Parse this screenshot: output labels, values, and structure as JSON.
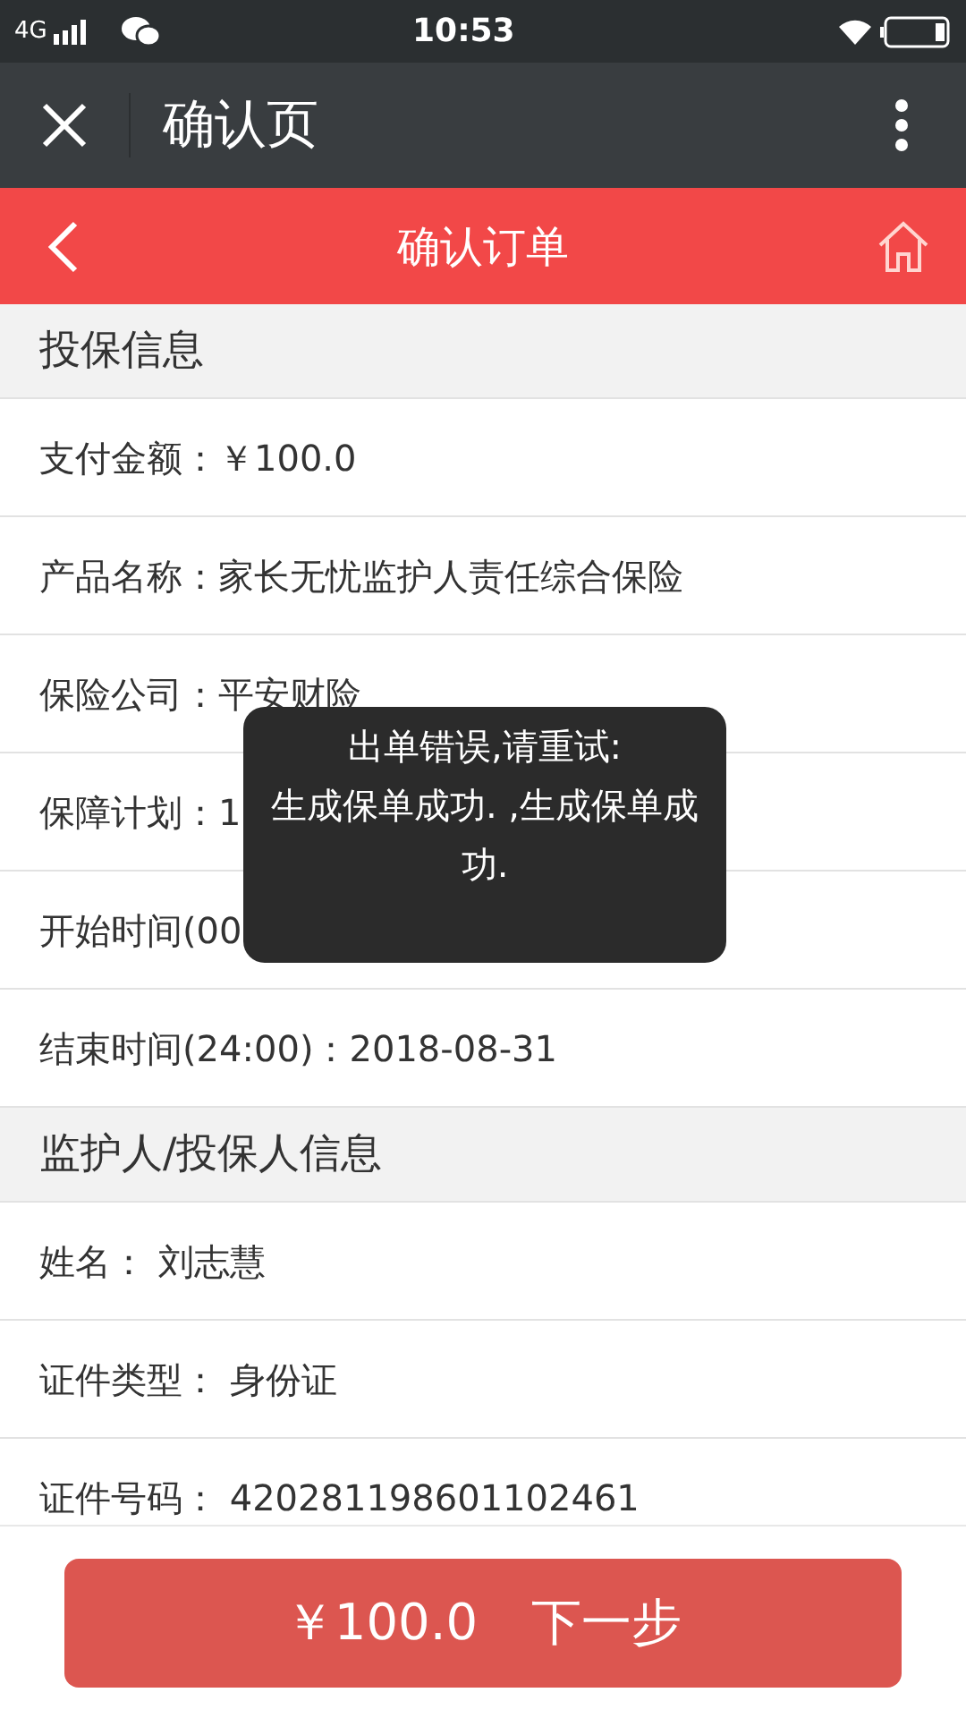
{
  "status_bar": {
    "network": "4G",
    "time": "10:53"
  },
  "app_bar": {
    "title": "确认页"
  },
  "header": {
    "title": "确认订单"
  },
  "sections": [
    {
      "title": "投保信息",
      "rows": [
        {
          "label": "支付金额：",
          "value": "￥100.0"
        },
        {
          "label": "产品名称：",
          "value": "家长无忧监护人责任综合保险"
        },
        {
          "label": "保险公司：",
          "value": "平安财险"
        },
        {
          "label": "保障计划：",
          "value": "1"
        },
        {
          "label": "开始时间(00"
        },
        {
          "label": "结束时间(24:00)：",
          "value": "2018-08-31"
        }
      ]
    },
    {
      "title": "监护人/投保人信息",
      "rows": [
        {
          "label": "姓名： ",
          "value": "刘志慧"
        },
        {
          "label": "证件类型： ",
          "value": "身份证"
        },
        {
          "label": "证件号码： ",
          "value": "420281198601102461"
        }
      ]
    }
  ],
  "toast": {
    "title": "出单错误,请重试:",
    "message": "生成保单成功. ,生成保单成功."
  },
  "footer": {
    "price": "￥100.0",
    "action": "下一步"
  }
}
